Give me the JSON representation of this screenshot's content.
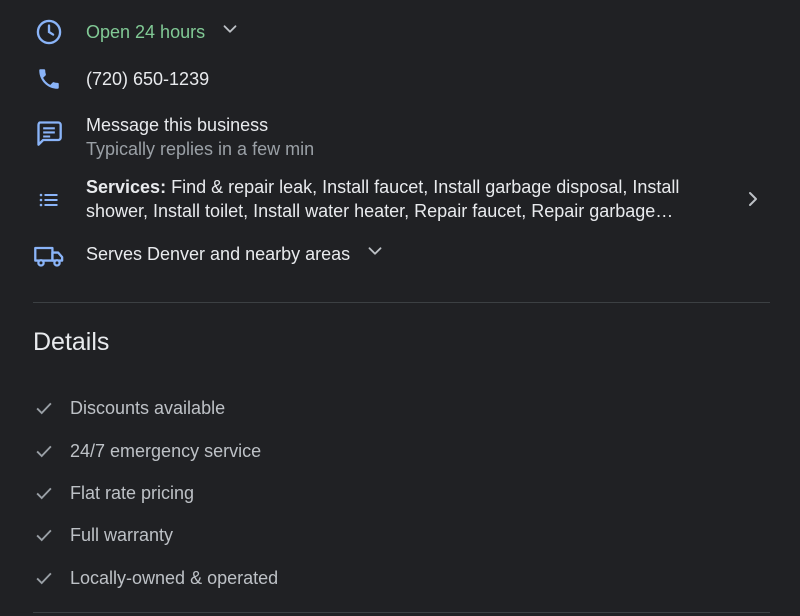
{
  "hours": {
    "status": "Open 24 hours",
    "icon": "clock-icon"
  },
  "phone": {
    "number": "(720) 650-1239",
    "icon": "phone-icon"
  },
  "message": {
    "title": "Message this business",
    "subtitle": "Typically replies in a few min",
    "icon": "chat-icon"
  },
  "services": {
    "label": "Services:",
    "text_line1": "Find & repair leak, Install faucet, Install garbage disposal, Install",
    "text_line2": "shower, Install toilet, Install water heater, Repair faucet, Repair garbage…",
    "icon": "list-icon"
  },
  "service_area": {
    "text": "Serves Denver and nearby areas",
    "icon": "truck-icon"
  },
  "details": {
    "title": "Details",
    "items": [
      "Discounts available",
      "24/7 emergency service",
      "Flat rate pricing",
      "Full warranty",
      "Locally-owned & operated"
    ]
  },
  "colors": {
    "background": "#202124",
    "accent_blue": "#8ab4f8",
    "open_green": "#81c995",
    "text_primary": "#e8eaed",
    "text_secondary": "#9aa0a6",
    "divider": "#3c4043"
  }
}
